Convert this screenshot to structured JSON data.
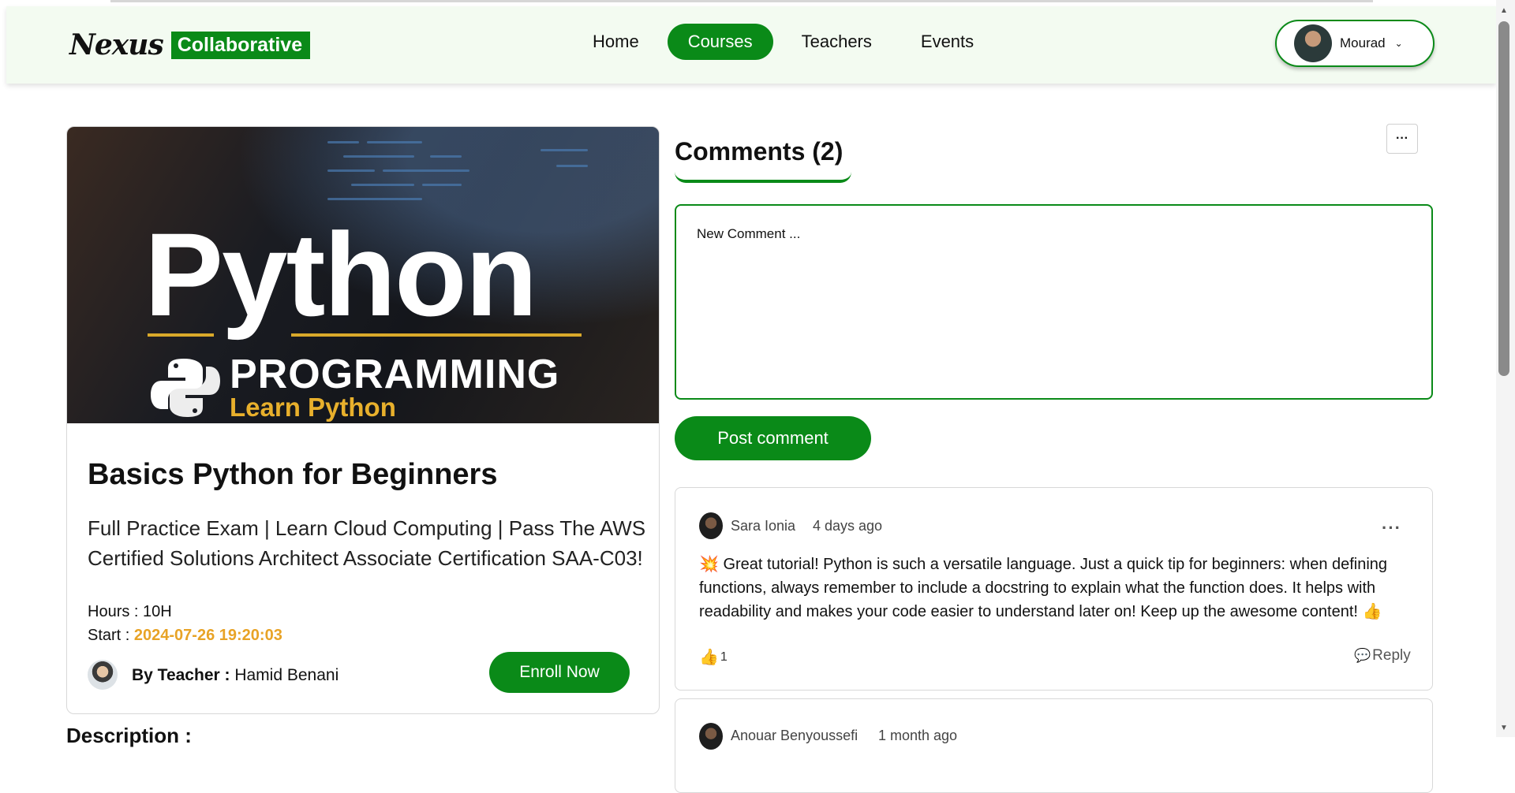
{
  "header": {
    "logo_script": "Nexus",
    "logo_box": "Collaborative",
    "nav": [
      {
        "label": "Home",
        "active": false
      },
      {
        "label": "Courses",
        "active": true
      },
      {
        "label": "Teachers",
        "active": false
      },
      {
        "label": "Events",
        "active": false
      }
    ],
    "user": {
      "name": "Mourad"
    }
  },
  "course": {
    "image_text": {
      "word": "Python",
      "sub": "PROGRAMMING",
      "tagline": "Learn Python"
    },
    "title": "Basics Python for Beginners",
    "description": "Full Practice Exam | Learn Cloud Computing | Pass The AWS Certified Solutions Architect Associate Certification SAA-C03!",
    "hours_label": "Hours : ",
    "hours_value": "10H",
    "start_label": "Start : ",
    "start_value": "2024-07-26 19:20:03",
    "teacher_label": "By Teacher : ",
    "teacher_name": "Hamid Benani",
    "enroll_label": "Enroll Now",
    "description_heading": "Description :"
  },
  "comments": {
    "title": "Comments (2)",
    "more_label": "···",
    "input_placeholder": "New Comment ...",
    "post_label": "Post comment",
    "items": [
      {
        "author": "Sara Ionia",
        "time": "4 days ago",
        "text": "💥 Great tutorial! Python is such a versatile language. Just a quick tip for beginners: when defining functions, always remember to include a docstring to explain what the function does. It helps with readability and makes your code easier to understand later on! Keep up the awesome content! 👍",
        "likes": "1",
        "reply_label": "Reply"
      },
      {
        "author": "Anouar Benyoussefi",
        "time": "1 month ago"
      }
    ]
  },
  "colors": {
    "accent": "#0a8a18",
    "date": "#e8a326",
    "header_bg": "#f3fbf1"
  }
}
